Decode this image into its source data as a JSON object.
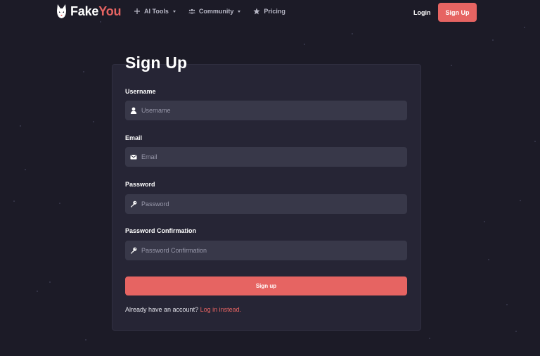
{
  "brand": {
    "name_a": "Fake",
    "name_b": "You",
    "accent_color": "#e66462"
  },
  "nav": {
    "links": [
      {
        "label": "AI Tools",
        "icon": "plus-icon",
        "has_caret": true
      },
      {
        "label": "Community",
        "icon": "users-icon",
        "has_caret": true
      },
      {
        "label": "Pricing",
        "icon": "star-icon",
        "has_caret": false
      }
    ],
    "login_label": "Login",
    "signup_label": "Sign Up"
  },
  "form": {
    "title": "Sign Up",
    "fields": [
      {
        "label": "Username",
        "placeholder": "Username",
        "icon": "user-icon",
        "value": ""
      },
      {
        "label": "Email",
        "placeholder": "Email",
        "icon": "envelope-icon",
        "value": ""
      },
      {
        "label": "Password",
        "placeholder": "Password",
        "icon": "key-icon",
        "value": ""
      },
      {
        "label": "Password Confirmation",
        "placeholder": "Password Confirmation",
        "icon": "key-icon",
        "value": ""
      }
    ],
    "submit_label": "Sign up",
    "already_text": "Already have an account?",
    "login_link": "Log in instead."
  }
}
